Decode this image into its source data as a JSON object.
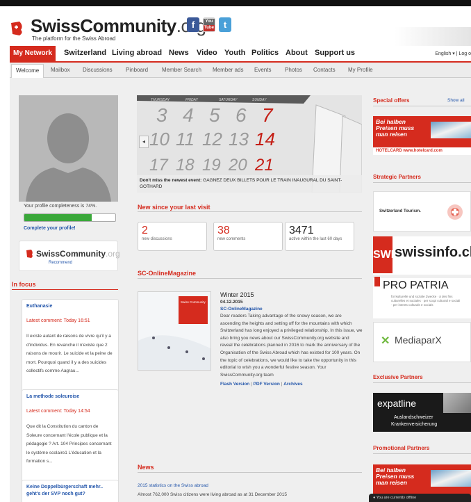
{
  "header": {
    "logo_name": "SwissCommunity",
    "logo_suffix": ".org",
    "tagline": "The platform for the Swiss Abroad",
    "social": {
      "facebook": "f",
      "youtube_top": "You",
      "youtube_bottom": "Tube",
      "twitter": "t"
    },
    "lang": "English ▾  |  Log o"
  },
  "main_nav": [
    "My Network",
    "Switzerland",
    "Living abroad",
    "News",
    "Video",
    "Youth",
    "Politics",
    "About",
    "Support us"
  ],
  "sub_nav": [
    "Welcome",
    "Mailbox",
    "Discussions",
    "Pinboard",
    "Member Search",
    "Member ads",
    "Events",
    "Photos",
    "Contacts",
    "My Profile"
  ],
  "profile": {
    "completeness_text": "Your profile completeness is 74%.",
    "completeness": 0.74,
    "complete_link": "Complete your profile!"
  },
  "sc_badge": {
    "name": "SwissCommunity",
    "suffix": ".org",
    "sub": "Recommend"
  },
  "in_focus": {
    "title": "In focus",
    "items": [
      {
        "title": "Euthanasie",
        "latest": "Latest comment: Today 16:51",
        "text": "Il existe autant de raisons de vivre qu'il y a d'individus. En revanche il n'existe que 2 raisons de mourir. Le suicide et la peine de mort. Pourquoi quand il y a des suicides collectifs comme Aagrau..."
      },
      {
        "title": "La methode soleuroise",
        "latest": "Latest comment: Today 14:54",
        "text": "Que dit la Constitution du canton de Soleure concernant l'école publique et la pédagogie ? Art. 104 Principes concernant le système scolaire1 L'éducation et la formation s..."
      },
      {
        "title": "Keine Doppelbürgerschaft mehr.. geht's der SVP noch gut?",
        "latest": "",
        "text": ""
      }
    ]
  },
  "banner": {
    "calendar_days": [
      "THURSDAY",
      "FRIDAY",
      "SATURDAY",
      "SUNDAY"
    ],
    "calendar_nums": [
      "3",
      "4",
      "5",
      "6",
      "7",
      "10",
      "11",
      "12",
      "13",
      "14",
      "17",
      "18",
      "19",
      "20",
      "21"
    ],
    "caption_bold": "Don't miss the newest event:",
    "caption_text": "GAGNEZ DEUX BILLETS POUR LE TRAIN INAUGURAL DU SAINT-GOTHARD",
    "prev": "◂"
  },
  "new_since": {
    "title": "New since your last visit",
    "stats": [
      {
        "num": "2",
        "label": "new discussions"
      },
      {
        "num": "38",
        "label": "new comments"
      },
      {
        "num": "3471",
        "label": "active within the last 60 days"
      }
    ]
  },
  "magazine": {
    "section_title": "SC-OnlineMagazine",
    "title": "Winter 2015",
    "date": "04.12.2015",
    "source": "SC-OnlineMagazine",
    "text": "Dear readers Taking advantage of the snowy season, we are ascending the heights and setting off for the mountains with which Switzerland has long enjoyed a privileged relationship. In this issue, we also bring you news about our SwissCommunity.org website and reveal the celebrations planned in 2016 to mark the anniversary of the Organisation of the Swiss Abroad which has existed for 100 years. On the topic of celebrations, we would like to take the opportunity in this editorial to wish you a wonderful festive season. Your SwissCommunity.org team",
    "links": [
      "Flash Version",
      "PDF Version",
      "Archives"
    ],
    "link_sep": " | ",
    "cover_brand": "Swiss Community"
  },
  "news": {
    "title": "News",
    "headline": "2015 statistics on the Swiss abroad",
    "text": "Almost 762,000 Swiss citizens were living abroad as at 31 December 2015"
  },
  "right": {
    "special_title": "Special offers",
    "show_all": "Show all",
    "promo_text": "Bei halben Preisen muss man reisen",
    "promo_bar": "HOTELCARD  www.hotelcard.com",
    "strategic_title": "Strategic Partners",
    "swiss_tourism": "Switzerland Tourism.",
    "swi_short": "SWI",
    "swi_name": "swissinfo.ch",
    "pro_patria": "PRO PATRIA",
    "pro_patria_sub": "für kulturelle und soziale Zwecke · à des fins culturelles et sociales · per scopi culturali e sociali · per intents culturals e socials",
    "mediaparx": "MediaparX",
    "exclusive_title": "Exclusive Partners",
    "expatline": "expatline",
    "expat_sub1": "Auslandschweizer",
    "expat_sub2": "Krankenversicherung",
    "promotional_title": "Promotional Partners"
  },
  "status": {
    "offline": "● You are currently offline"
  },
  "colors": {
    "accent": "#d52b1e",
    "link": "#2255aa",
    "progress": "#3aa83a"
  }
}
